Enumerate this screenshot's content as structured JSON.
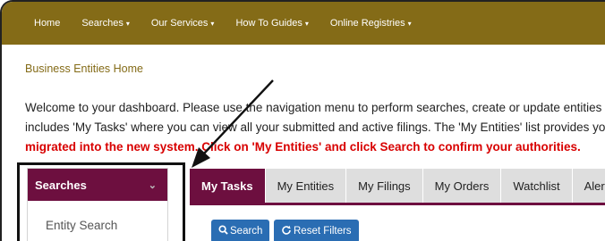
{
  "nav": {
    "items": [
      {
        "label": "Home",
        "caret": false
      },
      {
        "label": "Searches",
        "caret": true
      },
      {
        "label": "Our Services",
        "caret": true
      },
      {
        "label": "How To Guides",
        "caret": true
      },
      {
        "label": "Online Registries",
        "caret": true
      }
    ],
    "caret_glyph": "▾"
  },
  "breadcrumb": "Business Entities Home",
  "welcome": {
    "line1": "Welcome to your dashboard. Please use the navigation menu to perform searches, create or update entities and view help",
    "line2": "includes 'My Tasks' where you can view all your submitted and active filings. The 'My Entities' list provides you details on all",
    "line3": "migrated into the new system. Click on 'My Entities' and click Search to confirm your authorities."
  },
  "search_panel": {
    "title": "Searches",
    "chevron_glyph": "⌄",
    "items": [
      "Entity Search"
    ]
  },
  "tabs": [
    {
      "label": "My Tasks",
      "active": true
    },
    {
      "label": "My Entities",
      "active": false
    },
    {
      "label": "My Filings",
      "active": false
    },
    {
      "label": "My Orders",
      "active": false
    },
    {
      "label": "Watchlist",
      "active": false
    },
    {
      "label": "Alerts",
      "active": false
    }
  ],
  "buttons": {
    "search": {
      "label": "Search",
      "icon": "search-icon"
    },
    "reset": {
      "label": "Reset Filters",
      "icon": "refresh-icon"
    }
  },
  "colors": {
    "nav_bg": "#846b17",
    "accent": "#6d0f3f",
    "button": "#2a6db3",
    "warning_text": "#d80000"
  }
}
